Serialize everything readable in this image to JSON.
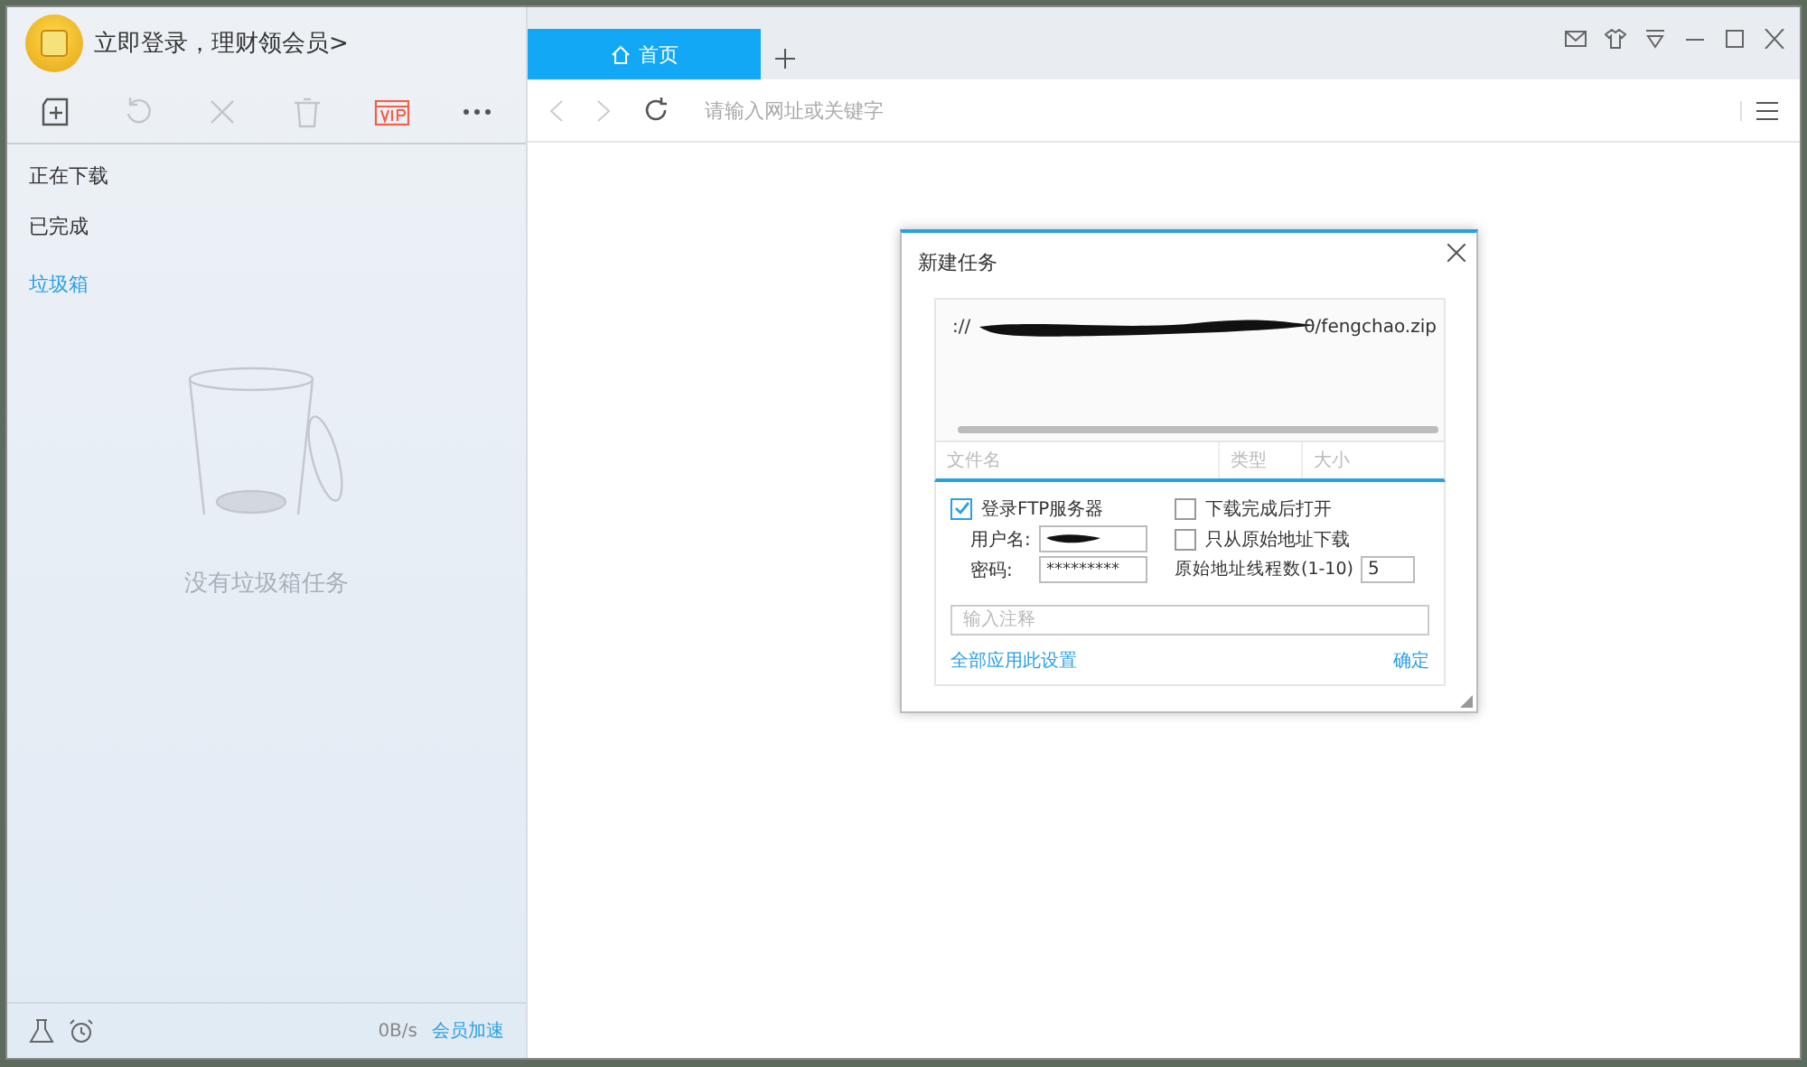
{
  "sidebar": {
    "login_text": "立即登录，理财领会员>",
    "toolbar": [
      {
        "kind": "new",
        "disabled": false
      },
      {
        "kind": "retry",
        "disabled": true
      },
      {
        "kind": "remove",
        "disabled": true
      },
      {
        "kind": "delete",
        "disabled": true
      },
      {
        "kind": "vip",
        "disabled": false
      },
      {
        "kind": "more",
        "disabled": false
      }
    ],
    "nav": [
      {
        "label": "正在下载",
        "selected": false
      },
      {
        "label": "已完成",
        "selected": false
      },
      {
        "label": "垃圾箱",
        "selected": true
      }
    ],
    "empty_text": "没有垃圾箱任务",
    "status": {
      "speed": "0B/s",
      "boost_link": "会员加速"
    }
  },
  "browser": {
    "tabs": [
      {
        "label": "首页",
        "selected": true
      }
    ],
    "address_placeholder": "请输入网址或关键字"
  },
  "dialog": {
    "title": "新建任务",
    "url_start": "://",
    "url_end": "0/fengchao.zip",
    "columns": [
      "文件名",
      "类型",
      "大小"
    ],
    "ftp": {
      "label": "登录FTP服务器",
      "checked": true,
      "username_label": "用户名:",
      "password_label": "密码:",
      "password": "*********"
    },
    "options": [
      {
        "label": "下载完成后打开",
        "checked": false
      },
      {
        "label": "只从原始地址下载",
        "checked": false
      }
    ],
    "threads": {
      "label": "原始地址线程数(1-10)",
      "value": "5"
    },
    "note_placeholder": "输入注释",
    "apply_all_link": "全部应用此设置",
    "ok_link": "确定"
  }
}
